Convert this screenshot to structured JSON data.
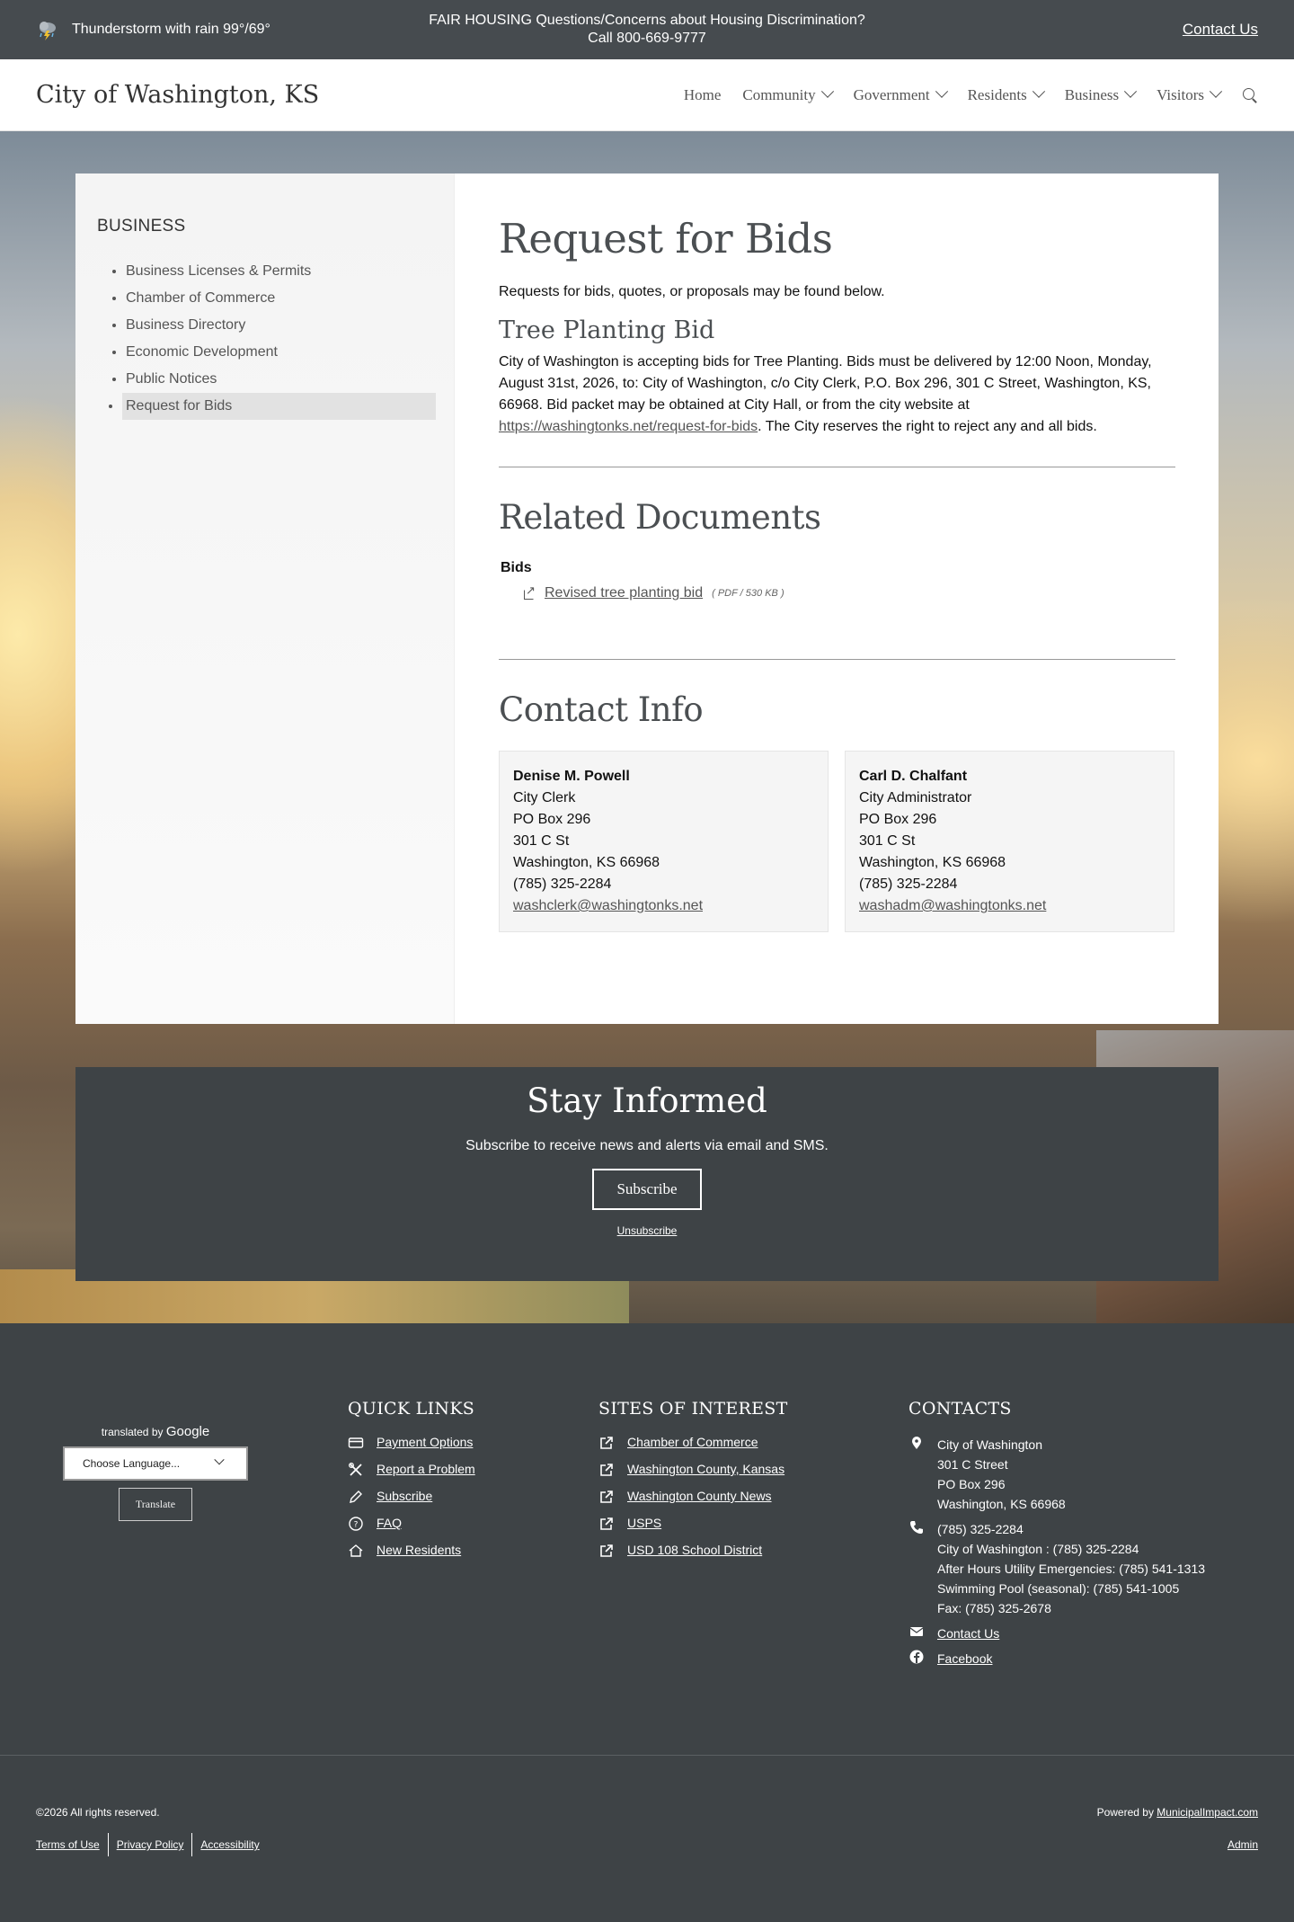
{
  "topbar": {
    "weather": "Thunderstorm with rain 99°/69°",
    "notice_line1": "FAIR HOUSING Questions/Concerns about Housing Discrimination?",
    "notice_line2": "Call 800-669-9777",
    "contact": "Contact Us"
  },
  "header": {
    "logo": "City of Washington, KS",
    "nav": [
      "Home",
      "Community",
      "Government",
      "Residents",
      "Business",
      "Visitors"
    ]
  },
  "sidebar": {
    "title": "BUSINESS",
    "items": [
      "Business Licenses & Permits",
      "Chamber of Commerce",
      "Business Directory",
      "Economic Development",
      "Public Notices",
      "Request for Bids"
    ]
  },
  "main": {
    "title": "Request for Bids",
    "intro": "Requests for bids, quotes, or proposals may be found below.",
    "bid_title": "Tree Planting Bid",
    "bid_text_1": "City of Washington is accepting bids for Tree Planting.  Bids must be delivered by 12:00 Noon, Monday, August 31st, 2026, to: City of Washington, c/o City Clerk, P.O. Box 296, 301 C Street, Washington, KS, 66968. Bid packet may be obtained at City Hall, or from the city website at ",
    "bid_link": "https://washingtonks.net/request-for-bids",
    "bid_text_2": ".  The City reserves the right to reject any and all bids.",
    "related_title": "Related Documents",
    "docs_label": "Bids",
    "doc_name": "Revised tree planting bid",
    "doc_meta": "( PDF / 530 KB )",
    "contact_title": "Contact Info",
    "contacts": [
      {
        "name": "Denise M. Powell",
        "role": "City Clerk",
        "box": "PO Box 296",
        "street": "301 C St",
        "city": "Washington, KS 66968",
        "phone": "(785) 325-2284",
        "email": "washclerk@washingtonks.net"
      },
      {
        "name": "Carl D. Chalfant",
        "role": "City Administrator",
        "box": "PO Box 296",
        "street": "301 C St",
        "city": "Washington, KS 66968",
        "phone": "(785) 325-2284",
        "email": "washadm@washingtonks.net"
      }
    ]
  },
  "subscribe": {
    "title": "Stay Informed",
    "text": "Subscribe to receive news and alerts via email and SMS.",
    "button": "Subscribe",
    "unsubscribe": "Unsubscribe"
  },
  "footer": {
    "translated_by": "translated by",
    "google": "Google",
    "language_select": "Choose Language...",
    "translate_button": "Translate",
    "quick_links_title": "QUICK LINKS",
    "quick_links": [
      "Payment Options",
      "Report a Problem",
      "Subscribe",
      "FAQ",
      "New Residents"
    ],
    "sites_title": "SITES OF INTEREST",
    "sites": [
      "Chamber of Commerce",
      "Washington County, Kansas",
      "Washington County News",
      "USPS",
      "USD 108 School District"
    ],
    "contacts_title": "CONTACTS",
    "address": [
      "City of Washington",
      "301 C Street",
      "PO Box 296",
      "Washington, KS 66968"
    ],
    "phones": [
      "(785) 325-2284",
      "City of Washington : (785) 325-2284",
      "After Hours Utility Emergencies: (785) 541-1313",
      "Swimming Pool (seasonal): (785) 541-1005",
      "Fax: (785) 325-2678"
    ],
    "contact_us": "Contact Us",
    "facebook": "Facebook"
  },
  "bottom": {
    "copyright": "©2026 All rights reserved.",
    "legal": [
      "Terms of Use",
      "Privacy Policy",
      "Accessibility"
    ],
    "powered_by": "Powered by ",
    "powered_link": "MunicipalImpact.com",
    "admin": "Admin"
  }
}
